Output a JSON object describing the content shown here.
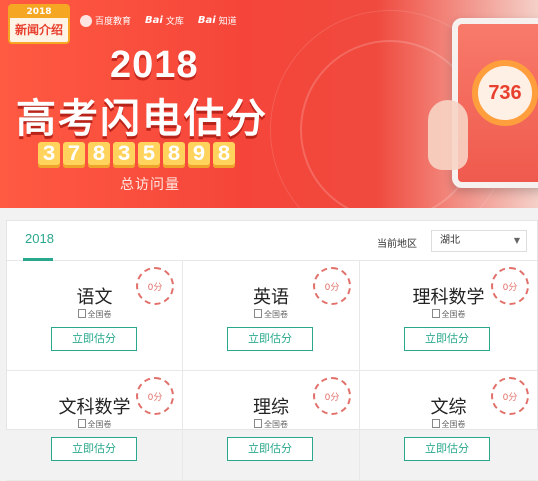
{
  "banner": {
    "badge_year": "2018",
    "badge_name": "新闻介绍",
    "partners": [
      "百度教育",
      "Bai",
      "文库",
      "Bai",
      "知道"
    ],
    "year": "2018",
    "title": "高考闪电估分",
    "counter_digits": [
      "3",
      "7",
      "8",
      "3",
      "5",
      "8",
      "9",
      "8"
    ],
    "counter_label": "总访问量",
    "score": "736"
  },
  "panel": {
    "tab_year": "2018",
    "region_label": "当前地区",
    "region_value": "湖北",
    "caret": "▼"
  },
  "cards": [
    {
      "subject": "语文",
      "paper": "全国卷",
      "button": "立即估分",
      "score": "0分"
    },
    {
      "subject": "英语",
      "paper": "全国卷",
      "button": "立即估分",
      "score": "0分"
    },
    {
      "subject": "理科数学",
      "paper": "全国卷",
      "button": "立即估分",
      "score": "0分"
    },
    {
      "subject": "文科数学",
      "paper": "全国卷",
      "button": "立即估分",
      "score": "0分"
    },
    {
      "subject": "理综",
      "paper": "全国卷",
      "button": "立即估分",
      "score": "0分"
    },
    {
      "subject": "文综",
      "paper": "全国卷",
      "button": "立即估分",
      "score": "0分"
    }
  ]
}
